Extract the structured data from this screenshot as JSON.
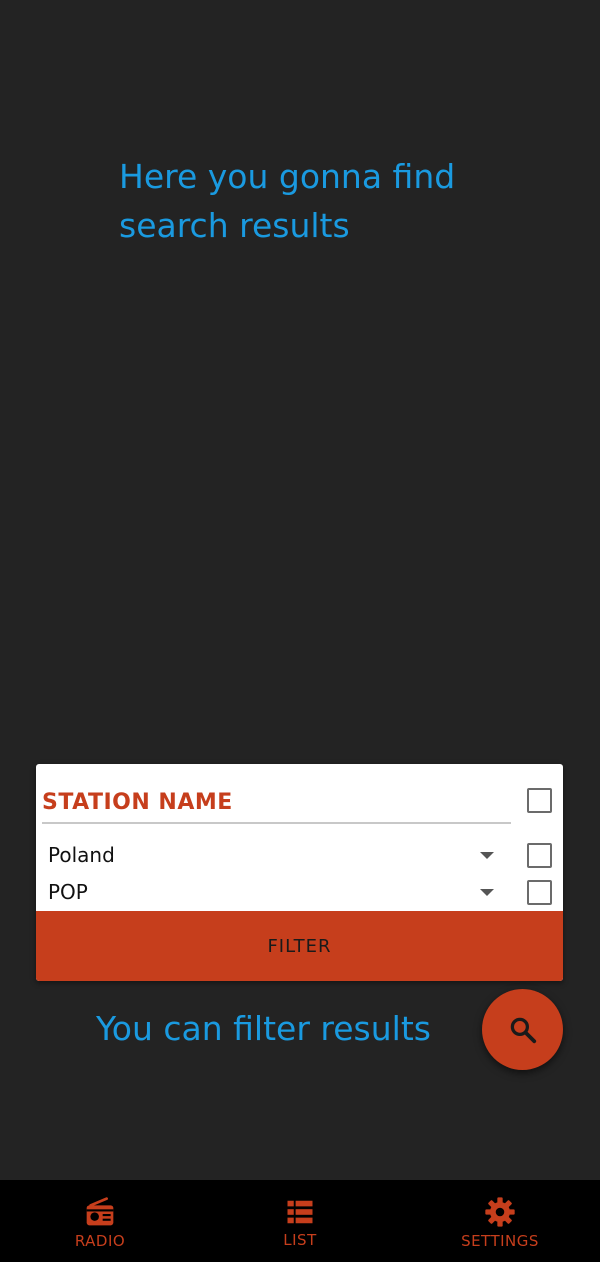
{
  "hints": {
    "top": "Here you gonna find search results",
    "bottom": "You can filter results"
  },
  "filter_card": {
    "station_name_placeholder": "STATION NAME",
    "country_value": "Poland",
    "genre_value": "POP",
    "filter_label": "FILTER"
  },
  "fab": {
    "icon": "search-icon"
  },
  "bottom_nav": {
    "items": [
      {
        "label": "RADIO",
        "icon": "radio-icon"
      },
      {
        "label": "LIST",
        "icon": "list-icon"
      },
      {
        "label": "SETTINGS",
        "icon": "gear-icon"
      }
    ]
  },
  "colors": {
    "background": "#232323",
    "accent": "#c63e1c",
    "hint_text": "#1a9ae0",
    "nav_background": "#000000"
  }
}
